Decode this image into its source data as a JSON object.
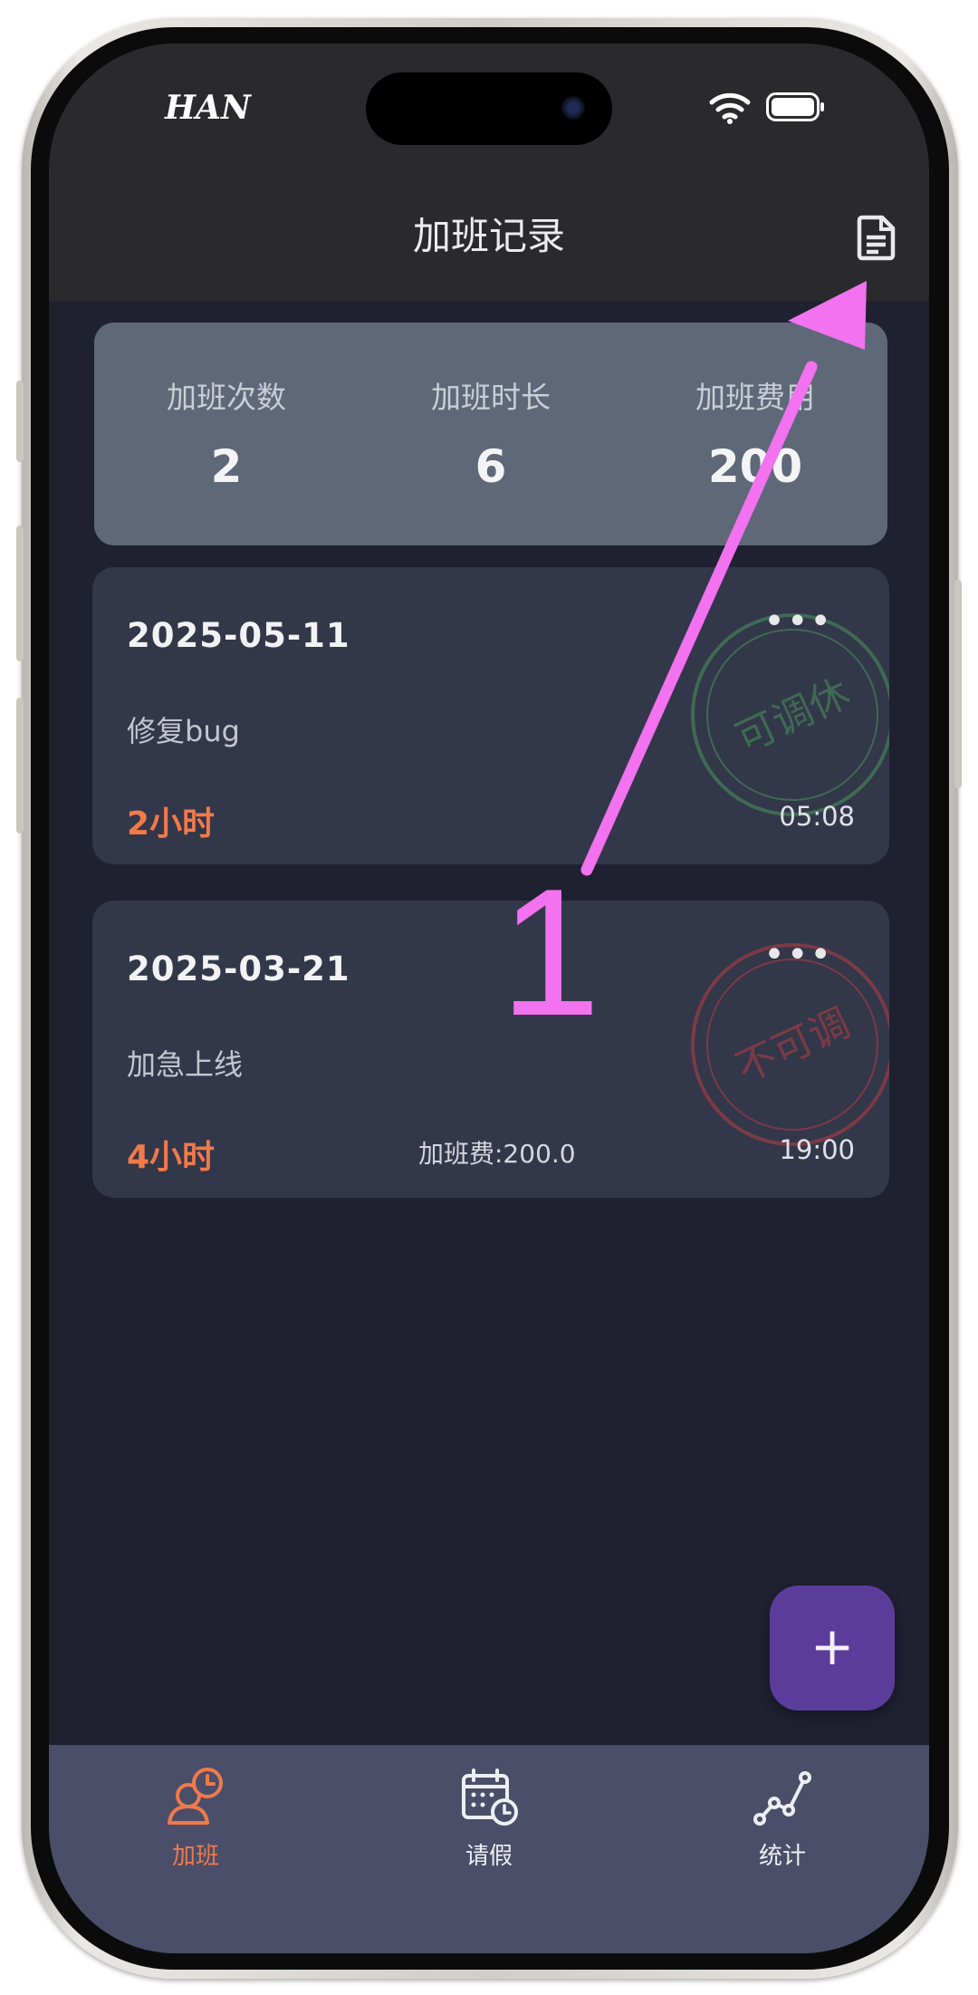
{
  "status_bar": {
    "carrier": "HAN"
  },
  "header": {
    "title": "加班记录"
  },
  "summary": [
    {
      "label": "加班次数",
      "value": "2"
    },
    {
      "label": "加班时长",
      "value": "6"
    },
    {
      "label": "加班费用",
      "value": "200"
    }
  ],
  "records": [
    {
      "date": "2025-05-11",
      "more": "•••",
      "desc": "修复bug",
      "hours": "2小时",
      "fee": "",
      "time": "05:08",
      "stamp": "可调休",
      "stamp_color": "#3f6a53"
    },
    {
      "date": "2025-03-21",
      "more": "•••",
      "desc": "加急上线",
      "hours": "4小时",
      "fee": "加班费:200.0",
      "time": "19:00",
      "stamp": "不可调",
      "stamp_color": "#7a3b45"
    }
  ],
  "fab": {
    "label": "+"
  },
  "tabs": [
    {
      "label": "加班",
      "icon": "overtime-icon",
      "active": true
    },
    {
      "label": "请假",
      "icon": "calendar-clock-icon",
      "active": false
    },
    {
      "label": "统计",
      "icon": "statistics-icon",
      "active": false
    }
  ],
  "colors": {
    "accent": "#f07a4a",
    "fab": "#5a3d9a",
    "annotation": "#f272ef",
    "background": "#1f2130",
    "card": "#33374a"
  },
  "annotation": {
    "label": "1"
  }
}
